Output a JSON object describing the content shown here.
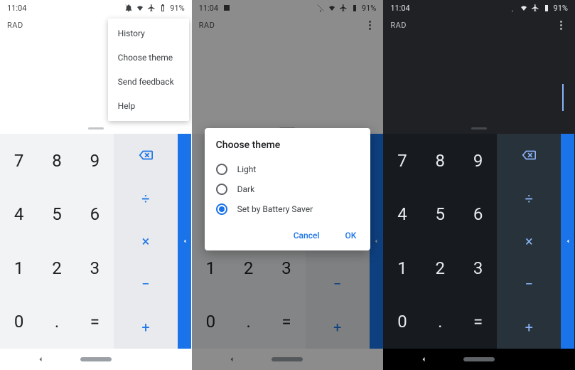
{
  "status": {
    "time": "11:04",
    "battery": "91%"
  },
  "app": {
    "mode": "RAD"
  },
  "menu": {
    "items": [
      "History",
      "Choose theme",
      "Send feedback",
      "Help"
    ]
  },
  "dialog": {
    "title": "Choose theme",
    "options": [
      "Light",
      "Dark",
      "Set by Battery Saver"
    ],
    "selected": 2,
    "cancel": "Cancel",
    "ok": "OK"
  },
  "keypad": {
    "digits": [
      "7",
      "8",
      "9",
      "4",
      "5",
      "6",
      "1",
      "2",
      "3",
      "0",
      ".",
      "="
    ],
    "ops": {
      "divide": "÷",
      "multiply": "×",
      "minus": "−",
      "plus": "+"
    }
  },
  "colors": {
    "accent": "#1a73e8",
    "dark_accent": "#8ab4f8"
  }
}
